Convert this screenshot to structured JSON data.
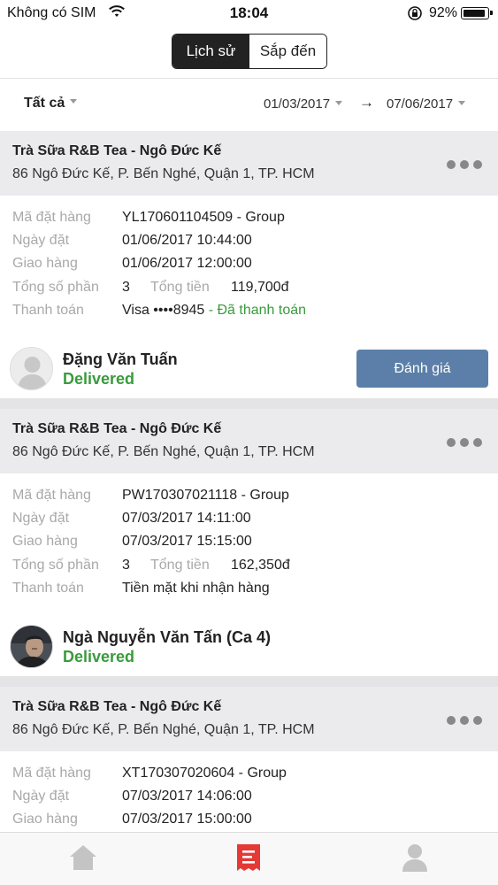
{
  "status_bar": {
    "carrier": "Không có SIM",
    "time": "18:04",
    "battery": "92%"
  },
  "segment": {
    "history": "Lịch sử",
    "upcoming": "Sắp đến",
    "selected": "history"
  },
  "filter": {
    "all": "Tất cả",
    "date_from": "01/03/2017",
    "arrow": "→",
    "date_to": "07/06/2017"
  },
  "labels": {
    "order_code": "Mã đặt hàng",
    "order_date": "Ngày đặt",
    "delivery": "Giao hàng",
    "total_items": "Tổng số phần",
    "total_price": "Tổng tiền",
    "payment": "Thanh toán",
    "rate": "Đánh giá"
  },
  "orders": [
    {
      "store_name": "Trà Sữa R&B Tea - Ngô Đức Kế",
      "store_address": "86 Ngô Đức Kế, P. Bến Nghé, Quận 1, TP. HCM",
      "order_code": "YL170601104509 - Group",
      "order_date": "01/06/2017 10:44:00",
      "delivery": "01/06/2017 12:00:00",
      "total_items": "3",
      "total_price": "119,700đ",
      "payment_method": "Visa ••••8945",
      "payment_status": " - Đã thanh toán",
      "driver_name": "Đặng Văn  Tuấn",
      "driver_status": "Delivered"
    },
    {
      "store_name": "Trà Sữa R&B Tea - Ngô Đức Kế",
      "store_address": "86 Ngô Đức Kế, P. Bến Nghé, Quận 1, TP. HCM",
      "order_code": "PW170307021118 - Group",
      "order_date": "07/03/2017 14:11:00",
      "delivery": "07/03/2017 15:15:00",
      "total_items": "3",
      "total_price": "162,350đ",
      "payment_method": "Tiền mặt khi nhận hàng",
      "payment_status": "",
      "driver_name": "Ngà Nguyễn Văn Tấn (Ca 4)",
      "driver_status": "Delivered"
    },
    {
      "store_name": "Trà Sữa R&B Tea - Ngô Đức Kế",
      "store_address": "86 Ngô Đức Kế, P. Bến Nghé, Quận 1, TP. HCM",
      "order_code": "XT170307020604 - Group",
      "order_date": "07/03/2017 14:06:00",
      "delivery": "07/03/2017 15:00:00"
    }
  ],
  "colors": {
    "accent_green": "#3a9a3d",
    "button_blue": "#5b7fa8",
    "tab_active_red": "#e53935",
    "header_gray": "#ebebee"
  },
  "tabs": [
    {
      "icon": "home-icon",
      "active": false
    },
    {
      "icon": "orders-icon",
      "active": true
    },
    {
      "icon": "profile-icon",
      "active": false
    }
  ]
}
